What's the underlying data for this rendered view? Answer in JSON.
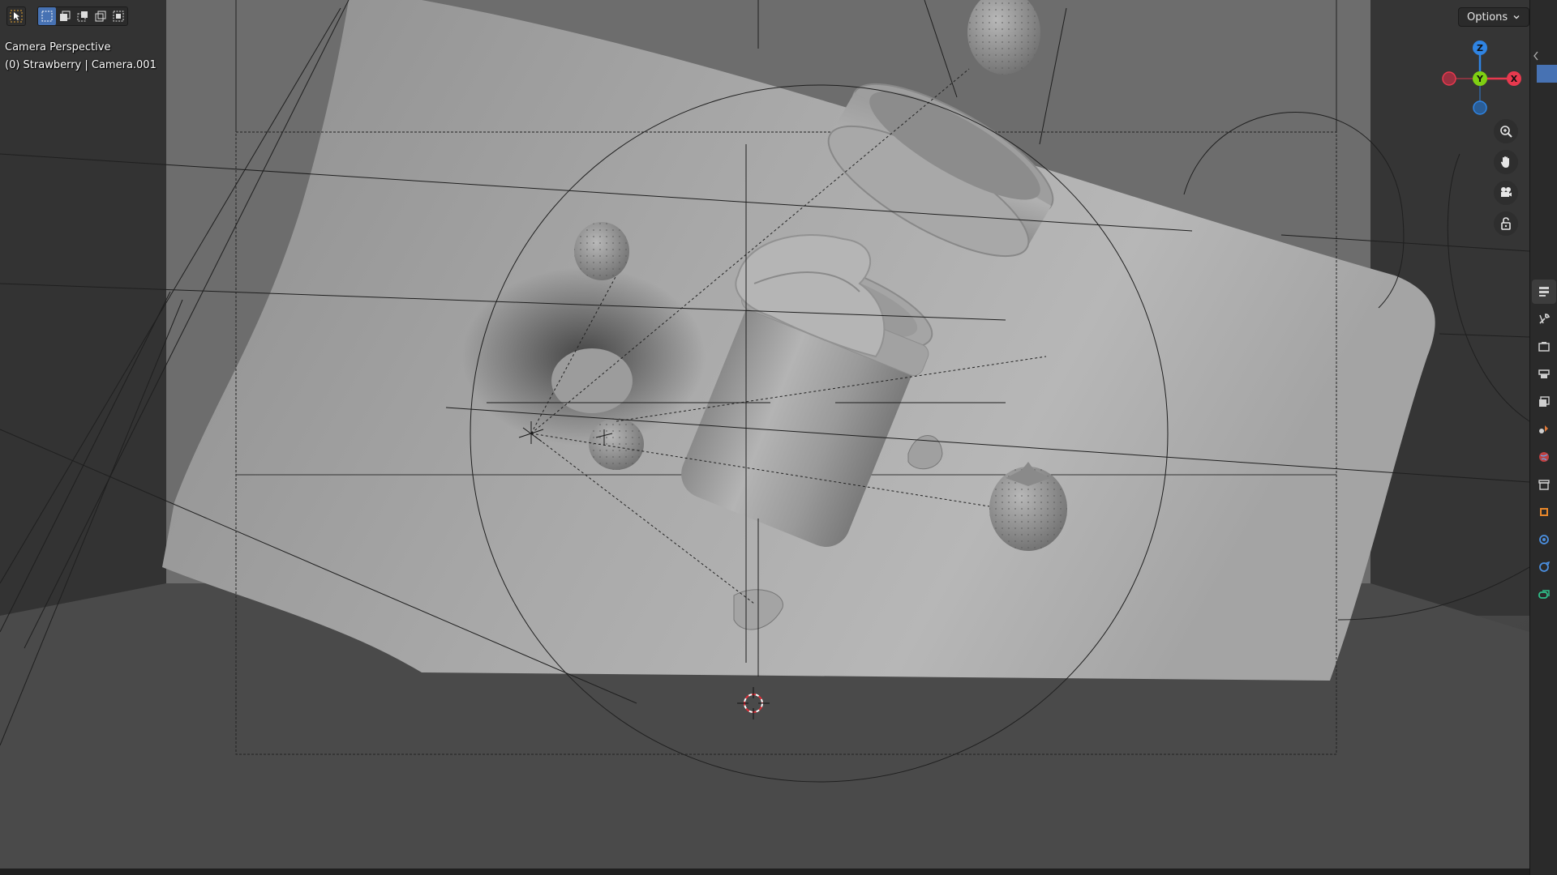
{
  "viewport": {
    "overlay_title": "Camera Perspective",
    "overlay_subtitle": "(0) Strawberry | Camera.001"
  },
  "header": {
    "tool_icon": "select-cursor-icon",
    "mode_icons": [
      "select-new-icon",
      "select-extend-icon",
      "select-subtract-icon",
      "select-invert-icon",
      "select-intersect-icon"
    ],
    "options_label": "Options"
  },
  "gizmo": {
    "x_label": "X",
    "y_label": "Y",
    "z_label": "Z",
    "x_color": "#e8394e",
    "y_color": "#7fcf12",
    "z_color": "#2f84e3"
  },
  "navigation": {
    "buttons": [
      "zoom-icon",
      "pan-hand-icon",
      "camera-view-icon",
      "lock-icon"
    ]
  },
  "properties_tabs": {
    "items": [
      "tool-icon",
      "render-icon",
      "output-icon",
      "view-layer-icon",
      "scene-icon",
      "world-icon",
      "collection-icon",
      "object-icon",
      "modifier-icon",
      "particles-icon",
      "physics-icon"
    ],
    "accent": "#4772b3"
  }
}
